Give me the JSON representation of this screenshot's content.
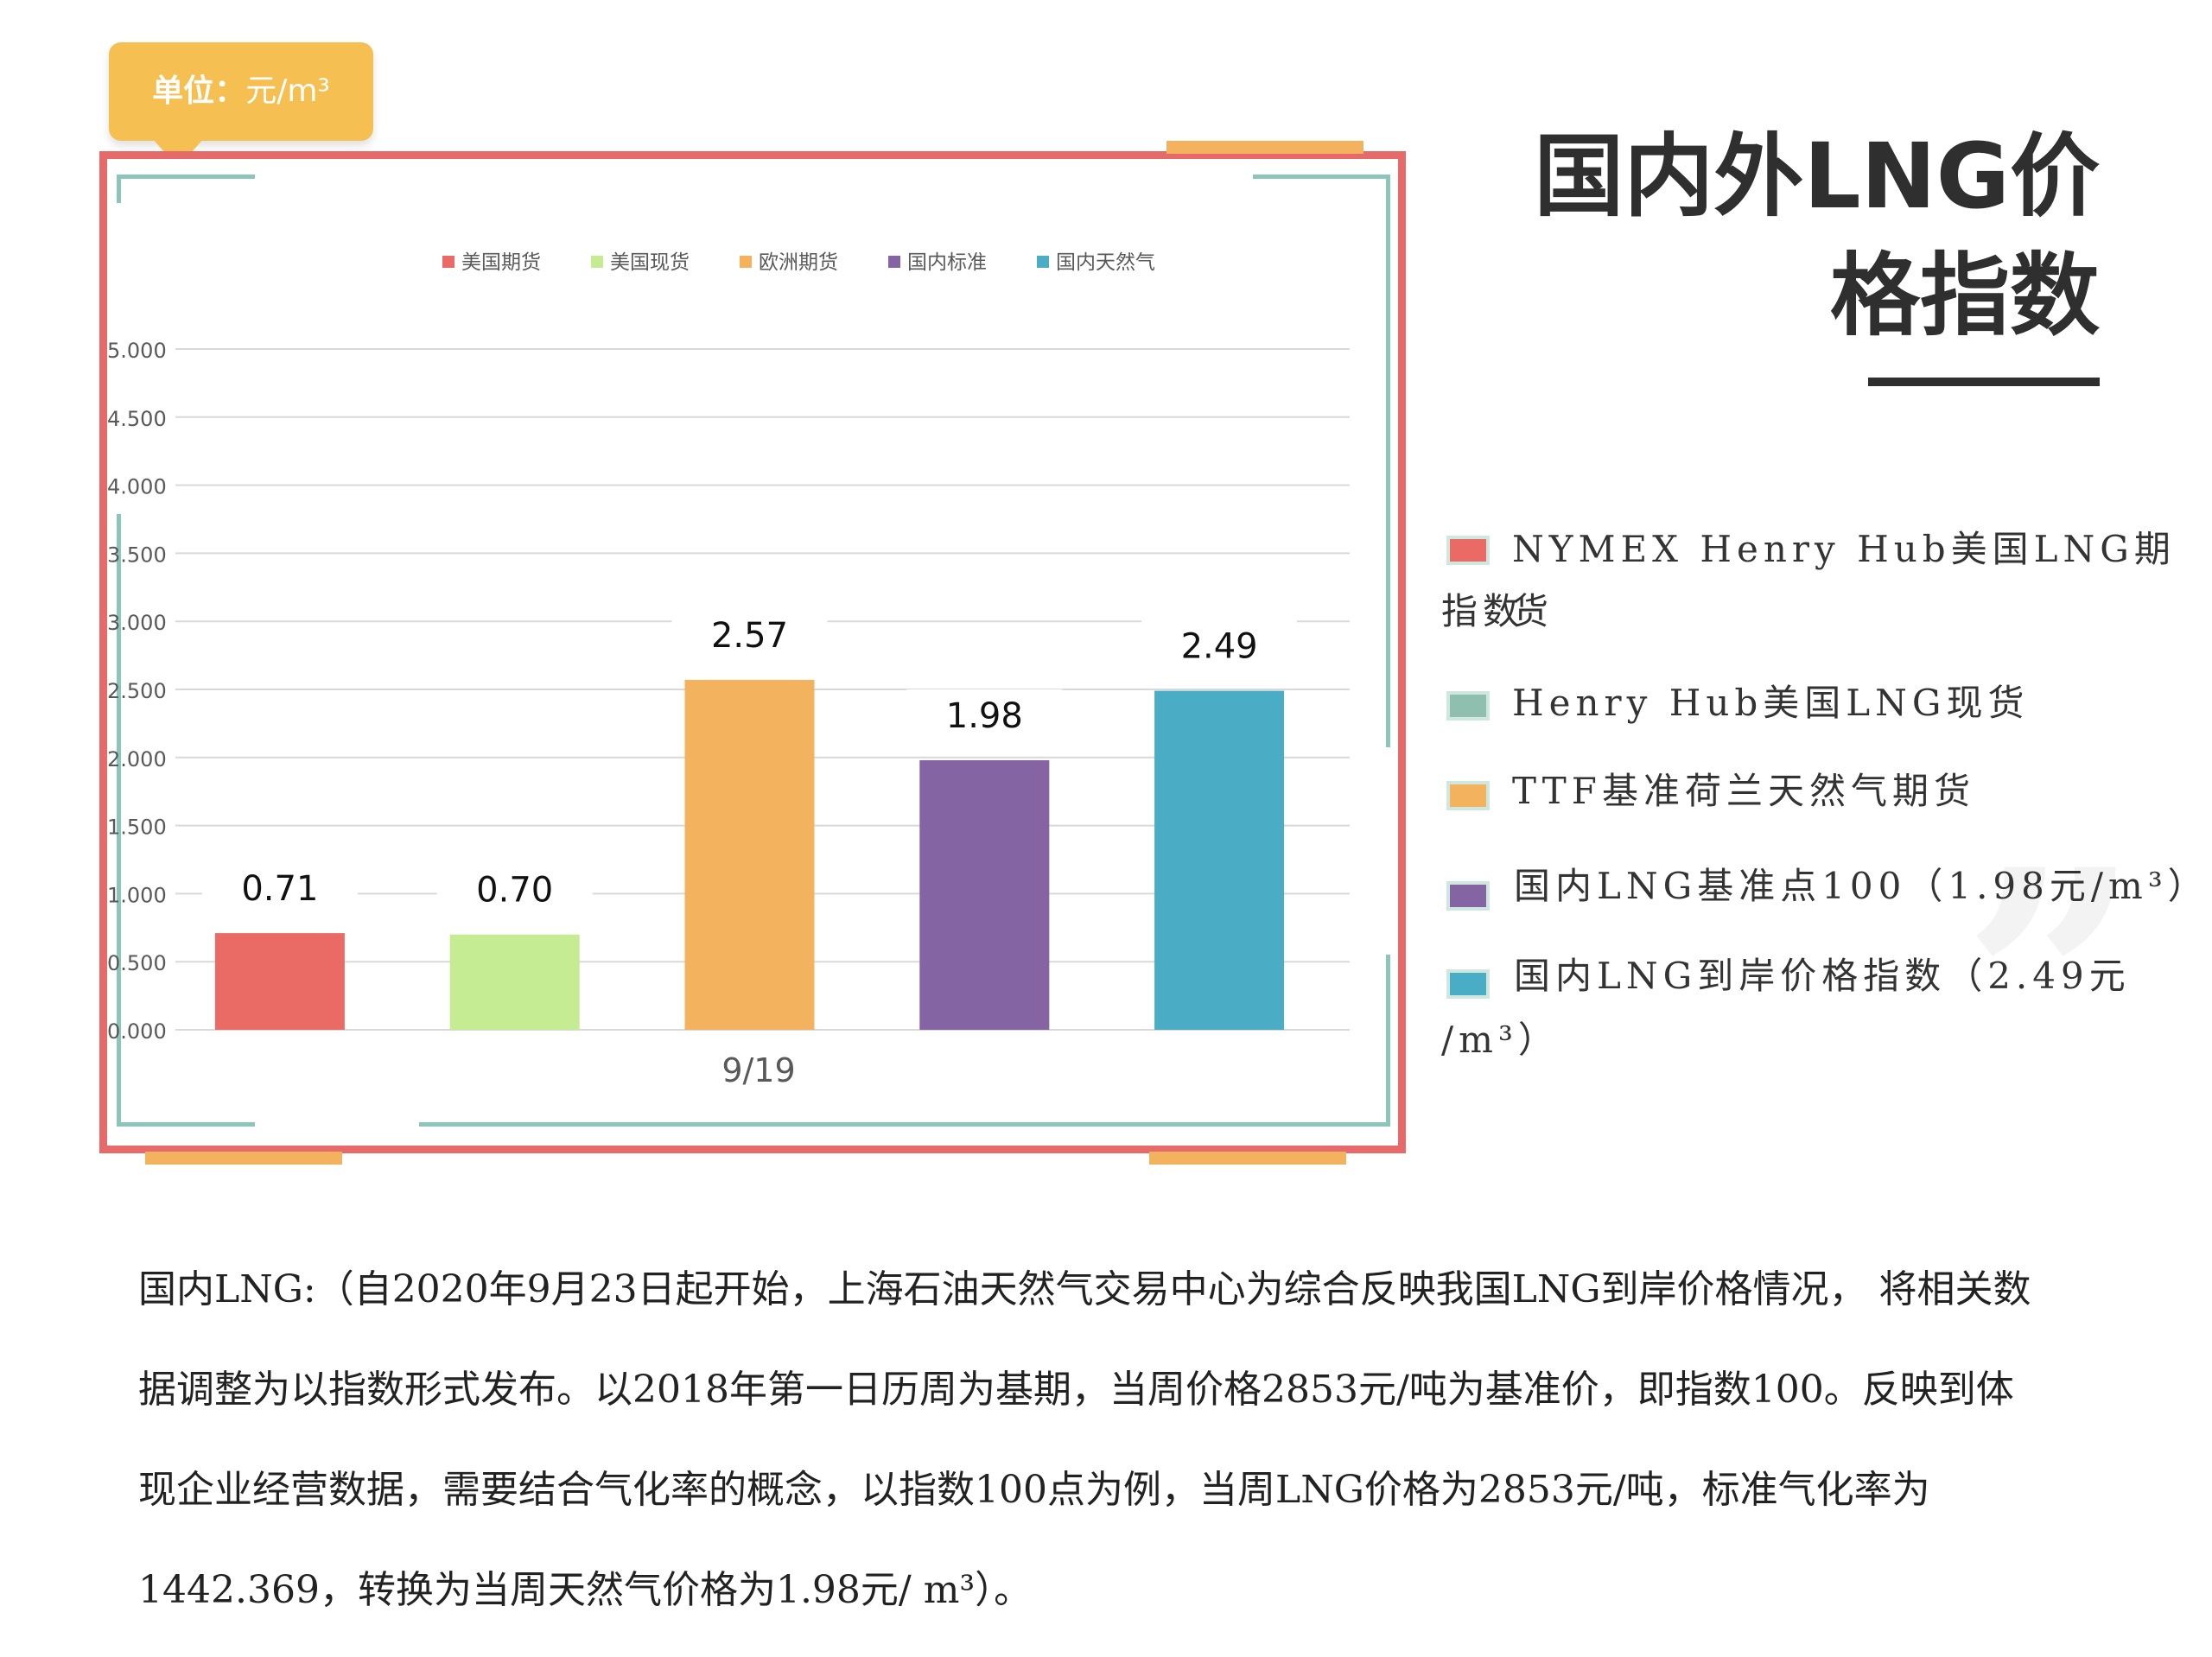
{
  "unit": {
    "label": "单位：",
    "value": "元/m³"
  },
  "title": {
    "line1": "国内外LNG价",
    "line2": "格指数"
  },
  "chart_data": {
    "type": "bar",
    "categories": [
      "9/19"
    ],
    "xlabel": "9/19",
    "ylim": [
      0,
      5
    ],
    "yticks": [
      "0.000",
      "0.500",
      "1.000",
      "1.500",
      "2.000",
      "2.500",
      "3.000",
      "3.500",
      "4.000",
      "4.500",
      "5.000"
    ],
    "grid": true,
    "legend_position": "top",
    "series": [
      {
        "name": "美国期货",
        "values": [
          0.71
        ],
        "label": "0.71",
        "color": "#ea6b66"
      },
      {
        "name": "美国现货",
        "values": [
          0.7
        ],
        "label": "0.70",
        "color": "#c6ec93"
      },
      {
        "name": "欧洲期货",
        "values": [
          2.57
        ],
        "label": "2.57",
        "color": "#f3b35e"
      },
      {
        "name": "国内标准",
        "values": [
          1.98
        ],
        "label": "1.98",
        "color": "#8464a3"
      },
      {
        "name": "国内天然气",
        "values": [
          2.49
        ],
        "label": "2.49",
        "color": "#4bacc6"
      }
    ]
  },
  "legend_right": [
    {
      "line1": "NYMEX Henry Hub美国LNG期货",
      "line2": "指数",
      "color": "#ea6b66"
    },
    {
      "line1": "Henry Hub美国LNG现货",
      "line2": "",
      "color": "#8fbfae"
    },
    {
      "line1": "TTF基准荷兰天然气期货",
      "line2": "",
      "color": "#f3b35e"
    },
    {
      "line1": "国内LNG基准点100（1.98元/m³）",
      "line2": "",
      "color": "#8464a3"
    },
    {
      "line1": "国内LNG到岸价格指数（2.49元",
      "line2": "/m³）",
      "color": "#4bacc6"
    }
  ],
  "paragraph": [
    "国内LNG:（自2020年9月23日起开始，上海石油天然气交易中心为综合反映我国LNG到岸价格情况， 将相关数",
    "据调整为以指数形式发布。以2018年第一日历周为基期，当周价格2853元/吨为基准价，即指数100。反映到体",
    "现企业经营数据，需要结合气化率的概念，以指数100点为例，当周LNG价格为2853元/吨，标准气化率为",
    "1442.369，转换为当周天然气价格为1.98元/ m³）。"
  ]
}
